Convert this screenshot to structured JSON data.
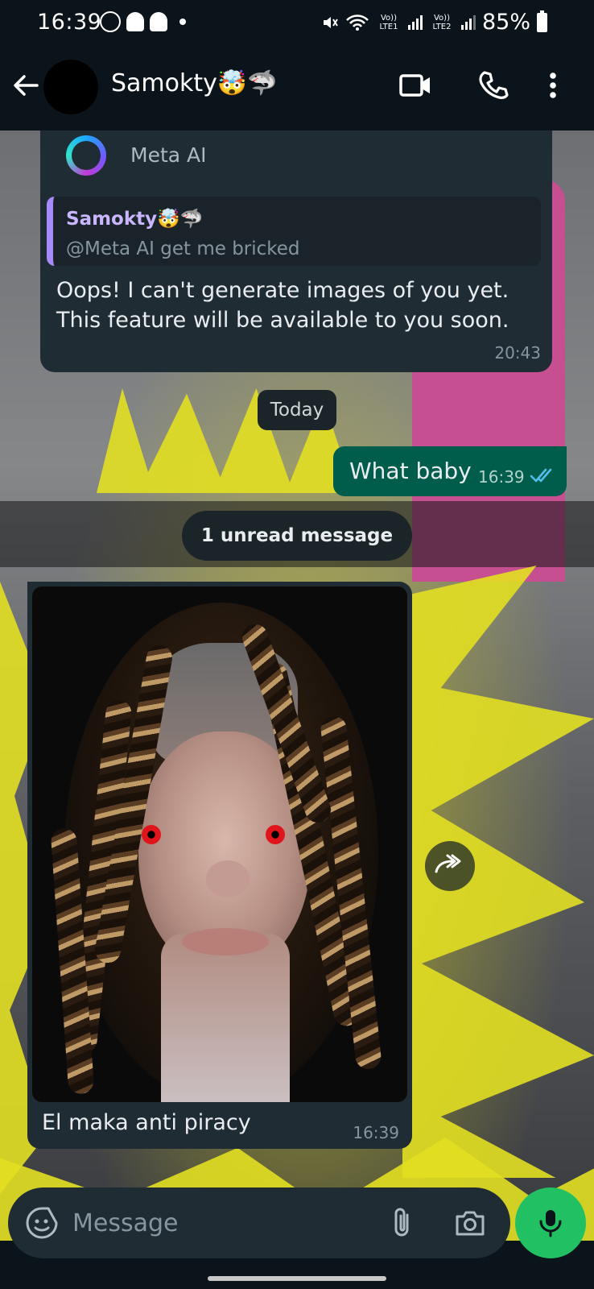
{
  "status_bar": {
    "time": "16:39",
    "notifications": [
      "whatsapp-icon",
      "snapchat-icon",
      "snapchat-icon",
      "dot-icon"
    ],
    "sim1": "Vo)) LTE1",
    "sim2": "Vo)) LTE2",
    "battery": "85%"
  },
  "header": {
    "contact_name": "Samokty🤯🦈",
    "icons": [
      "back-arrow-icon",
      "video-call-icon",
      "voice-call-icon",
      "more-options-icon"
    ]
  },
  "messages": {
    "meta_card": {
      "source": "Meta AI",
      "quote_author": "Samokty🤯🦈",
      "quote_text": "@Meta AI get me bricked",
      "reply": "Oops! I can't generate images of you yet. This feature will be available to you soon.",
      "time": "20:43"
    },
    "date_divider": "Today",
    "outgoing": {
      "text": "What baby",
      "time": "16:39",
      "status": "read"
    },
    "unread_divider": "1 unread message",
    "image_message": {
      "caption": "El maka anti piracy",
      "time": "16:39"
    }
  },
  "composer": {
    "placeholder": "Message",
    "value": ""
  },
  "colors": {
    "background": "#0b141a",
    "incoming_bubble": "#202c33",
    "outgoing_bubble": "#005c4b",
    "accent_green": "#21c063",
    "read_ticks": "#53bdeb"
  }
}
